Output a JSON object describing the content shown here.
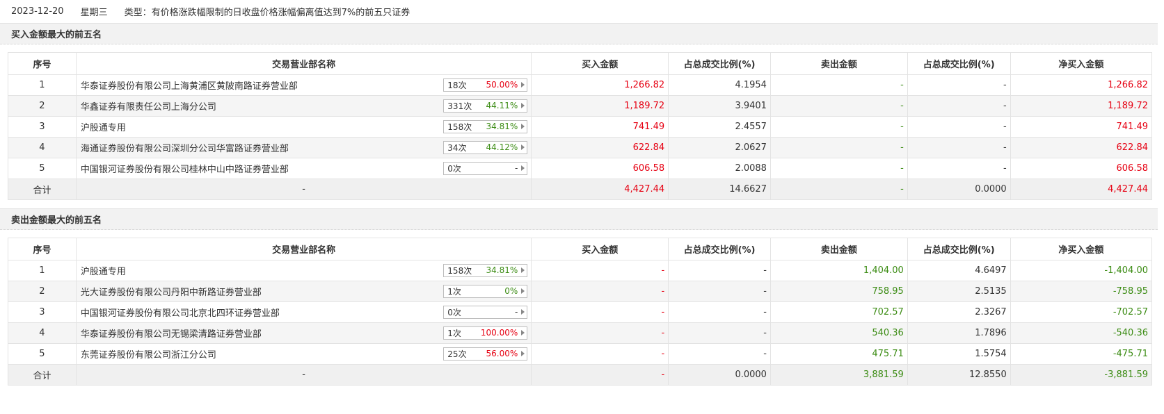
{
  "header": {
    "date": "2023-12-20",
    "weekday": "星期三",
    "type": "类型：有价格涨跌幅限制的日收盘价格涨幅偏离值达到7%的前五只证券"
  },
  "columns": [
    "序号",
    "交易营业部名称",
    "买入金额",
    "占总成交比例(%)",
    "卖出金额",
    "占总成交比例(%)",
    "净买入金额"
  ],
  "buy_section": {
    "title": "买入金额最大的前五名",
    "rows": [
      {
        "no": "1",
        "name": "华泰证券股份有限公司上海黄浦区黄陂南路证券营业部",
        "times": "18次",
        "rate": "50.00%",
        "rate_color": "red",
        "buy": "1,266.82",
        "buy_pct": "4.1954",
        "sell": "-",
        "sell_pct": "-",
        "net": "1,266.82"
      },
      {
        "no": "2",
        "name": "华鑫证券有限责任公司上海分公司",
        "times": "331次",
        "rate": "44.11%",
        "rate_color": "green",
        "buy": "1,189.72",
        "buy_pct": "3.9401",
        "sell": "-",
        "sell_pct": "-",
        "net": "1,189.72"
      },
      {
        "no": "3",
        "name": "沪股通专用",
        "times": "158次",
        "rate": "34.81%",
        "rate_color": "green",
        "buy": "741.49",
        "buy_pct": "2.4557",
        "sell": "-",
        "sell_pct": "-",
        "net": "741.49"
      },
      {
        "no": "4",
        "name": "海通证券股份有限公司深圳分公司华富路证券营业部",
        "times": "34次",
        "rate": "44.12%",
        "rate_color": "green",
        "buy": "622.84",
        "buy_pct": "2.0627",
        "sell": "-",
        "sell_pct": "-",
        "net": "622.84"
      },
      {
        "no": "5",
        "name": "中国银河证券股份有限公司桂林中山中路证券营业部",
        "times": "0次",
        "rate": "-",
        "rate_color": "plain",
        "buy": "606.58",
        "buy_pct": "2.0088",
        "sell": "-",
        "sell_pct": "-",
        "net": "606.58"
      }
    ],
    "total": {
      "label": "合计",
      "name": "-",
      "buy": "4,427.44",
      "buy_pct": "14.6627",
      "sell": "-",
      "sell_pct": "0.0000",
      "net": "4,427.44"
    }
  },
  "sell_section": {
    "title": "卖出金额最大的前五名",
    "rows": [
      {
        "no": "1",
        "name": "沪股通专用",
        "times": "158次",
        "rate": "34.81%",
        "rate_color": "green",
        "buy": "-",
        "buy_pct": "-",
        "sell": "1,404.00",
        "sell_pct": "4.6497",
        "net": "-1,404.00"
      },
      {
        "no": "2",
        "name": "光大证券股份有限公司丹阳中新路证券营业部",
        "times": "1次",
        "rate": "0%",
        "rate_color": "green",
        "buy": "-",
        "buy_pct": "-",
        "sell": "758.95",
        "sell_pct": "2.5135",
        "net": "-758.95"
      },
      {
        "no": "3",
        "name": "中国银河证券股份有限公司北京北四环证券营业部",
        "times": "0次",
        "rate": "-",
        "rate_color": "plain",
        "buy": "-",
        "buy_pct": "-",
        "sell": "702.57",
        "sell_pct": "2.3267",
        "net": "-702.57"
      },
      {
        "no": "4",
        "name": "华泰证券股份有限公司无锡梁清路证券营业部",
        "times": "1次",
        "rate": "100.00%",
        "rate_color": "red",
        "buy": "-",
        "buy_pct": "-",
        "sell": "540.36",
        "sell_pct": "1.7896",
        "net": "-540.36"
      },
      {
        "no": "5",
        "name": "东莞证券股份有限公司浙江分公司",
        "times": "25次",
        "rate": "56.00%",
        "rate_color": "red",
        "buy": "-",
        "buy_pct": "-",
        "sell": "475.71",
        "sell_pct": "1.5754",
        "net": "-475.71"
      }
    ],
    "total": {
      "label": "合计",
      "name": "-",
      "buy": "-",
      "buy_pct": "0.0000",
      "sell": "3,881.59",
      "sell_pct": "12.8550",
      "net": "-3,881.59"
    }
  },
  "colors": {
    "red": "#e60012",
    "green": "#3c8c14",
    "zebra": "#f5f5f5",
    "section_bg": "#f2f2f2"
  },
  "icons": {
    "badge_arrow": "caret-right-icon"
  }
}
